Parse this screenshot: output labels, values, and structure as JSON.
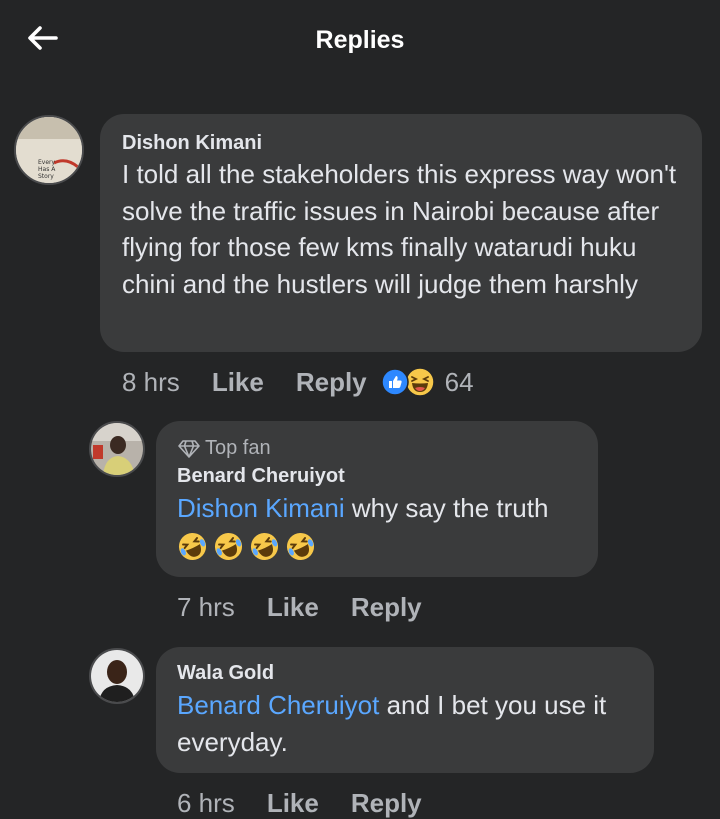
{
  "header": {
    "title": "Replies"
  },
  "comments": [
    {
      "author": "Dishon Kimani",
      "text": "I told all the stakeholders this express way won't solve the traffic issues in Nairobi because after flying for those few kms finally watarudi huku chini and the hustlers will judge them harshly",
      "avatar_caption": "Every Person Has A Story",
      "time": "8 hrs",
      "like_label": "Like",
      "reply_label": "Reply",
      "reaction_count": "64",
      "reactions": [
        "like-icon",
        "haha-icon"
      ]
    },
    {
      "badge": "Top fan",
      "author": "Benard Cheruiyot",
      "mention": "Dishon Kimani",
      "text": " why say the truth",
      "emoji_line": [
        "rolling-on-floor-laughing-emoji",
        "rolling-on-floor-laughing-emoji",
        "rolling-on-floor-laughing-emoji",
        "rolling-on-floor-laughing-emoji"
      ],
      "time": "7 hrs",
      "like_label": "Like",
      "reply_label": "Reply"
    },
    {
      "author": "Wala Gold",
      "mention": "Benard Cheruiyot",
      "text": " and I bet you use it everyday.",
      "time": "6 hrs",
      "like_label": "Like",
      "reply_label": "Reply"
    }
  ],
  "colors": {
    "background": "#242526",
    "bubble": "#3a3b3c",
    "mention": "#5aa7ff",
    "like_blue": "#2d88ff",
    "haha_yellow": "#f7c84a"
  }
}
